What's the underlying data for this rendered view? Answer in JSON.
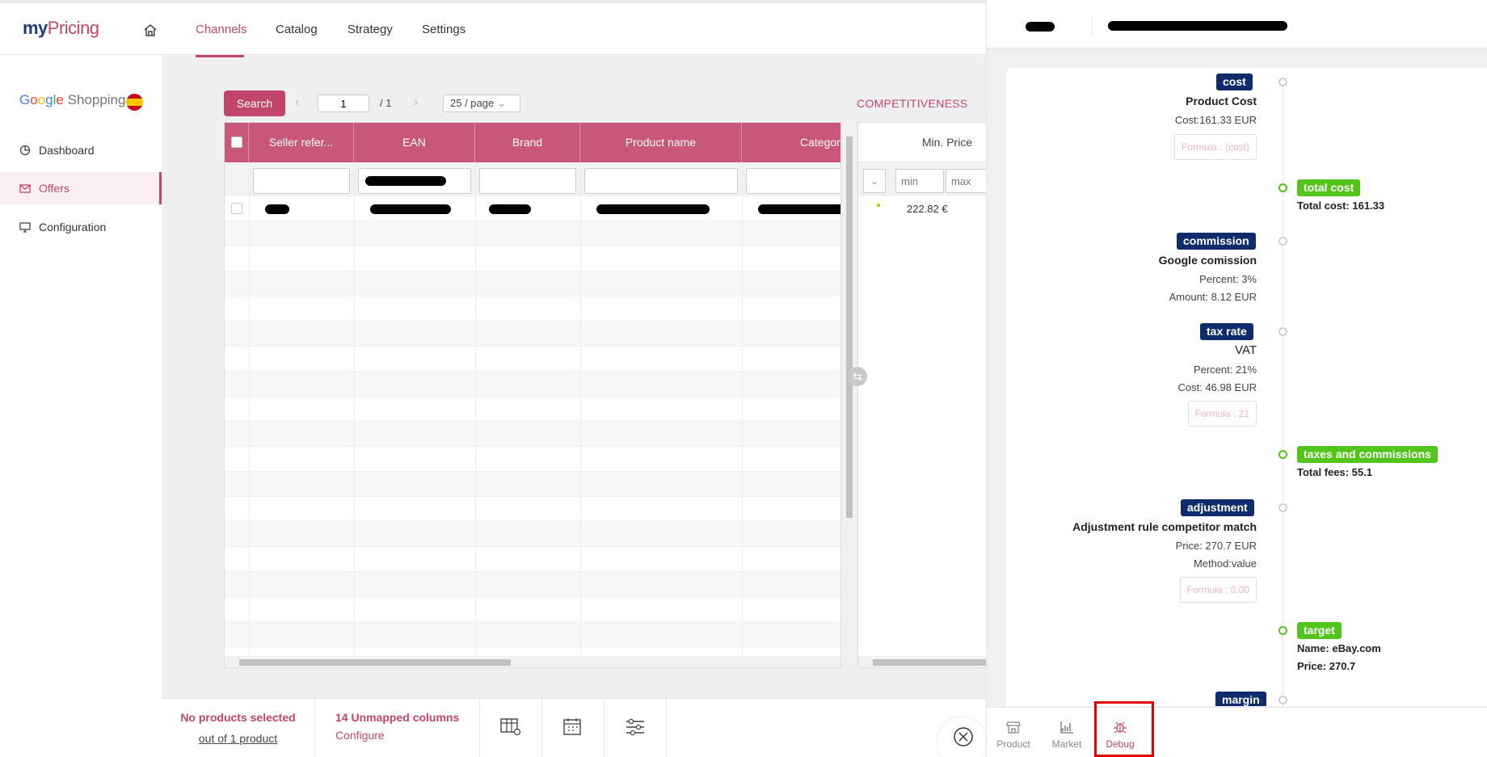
{
  "app": {
    "logo_my": "my",
    "logo_pricing": "Pricing"
  },
  "topnav": [
    {
      "label": "Channels"
    },
    {
      "label": "Catalog"
    },
    {
      "label": "Strategy"
    },
    {
      "label": "Settings"
    }
  ],
  "sidebar": {
    "channel_name": "Google Shopping",
    "items": [
      {
        "label": "Dashboard"
      },
      {
        "label": "Offers"
      },
      {
        "label": "Configuration"
      }
    ]
  },
  "toolbar": {
    "search_label": "Search",
    "page_value": "1",
    "page_total": "/ 1",
    "page_size": "25 / page",
    "competitiveness": "COMPETITIVENESS"
  },
  "table": {
    "columns": [
      "Seller refer...",
      "EAN",
      "Brand",
      "Product name",
      "Category"
    ],
    "competitiveness_columns": [
      "Min. Price"
    ],
    "min_placeholder": "min",
    "max_placeholder": "max",
    "rows": [
      {
        "min_price": "222.82 €"
      }
    ]
  },
  "bottombar": {
    "selected_text": "No products selected",
    "out_of": "out of 1 product",
    "unmapped": "14 Unmapped columns",
    "configure": "Configure"
  },
  "panel": {
    "tabs": [
      {
        "label": "Product",
        "icon": "store-icon"
      },
      {
        "label": "Market",
        "icon": "chart-icon"
      },
      {
        "label": "Debug",
        "icon": "bug-icon"
      }
    ],
    "timeline": {
      "cost": {
        "tag": "cost",
        "title": "Product Cost",
        "line1": "Cost:161.33 EUR",
        "formula": "Formula : {cost}"
      },
      "total_cost": {
        "tag": "total cost",
        "line1": "Total cost: 161.33"
      },
      "commission": {
        "tag": "commission",
        "title": "Google comission",
        "line1": "Percent: 3%",
        "line2": "Amount: 8.12 EUR"
      },
      "tax_rate": {
        "tag": "tax rate",
        "title": "VAT",
        "line1": "Percent: 21%",
        "line2": "Cost: 46.98 EUR",
        "formula": "Formula : 21"
      },
      "taxes": {
        "tag": "taxes and commissions",
        "line1": "Total fees: 55.1"
      },
      "adjustment": {
        "tag": "adjustment",
        "title": "Adjustment rule competitor match",
        "line1": "Price: 270.7 EUR",
        "line2": "Method:value",
        "formula": "Formula : 0.00"
      },
      "target": {
        "tag": "target",
        "line1": "Name: eBay.com",
        "line2": "Price: 270.7"
      },
      "margin": {
        "tag": "margin"
      }
    }
  },
  "colors": {
    "accent": "#c2456b",
    "navy": "#0f2b6b",
    "green": "#52c41a"
  }
}
